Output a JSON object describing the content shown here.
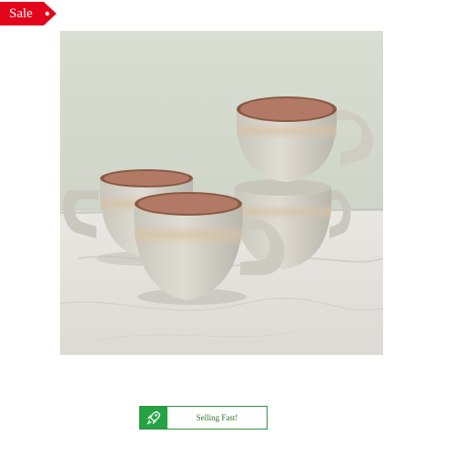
{
  "sale_tag": {
    "label": "Sale",
    "color": "#e3051b"
  },
  "product_image": {
    "subject": "stacked-ceramic-mugs",
    "palette": {
      "wall": "#d7dcd1",
      "marble": "#e6e4df",
      "mug_glaze": "#d5d2c8",
      "mug_interior": "#b07865",
      "mug_rim": "#8a5a42"
    }
  },
  "selling_badge": {
    "text": "Selling Fast!",
    "icon": "rocket-icon",
    "accent": "#25a244"
  }
}
